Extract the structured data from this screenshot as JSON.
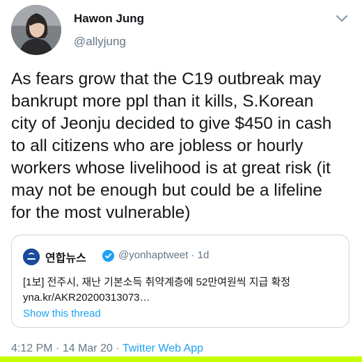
{
  "author": {
    "name": "Hawon Jung",
    "handle": "@allyjung"
  },
  "tweet": {
    "lines": [
      "As fears grow that the C19 outbreak may",
      "bankrupt more ppl than it kills, S.Korean",
      "city of Jeonju decided to give $450 in cash",
      "to all citizens who are jobless or hourly",
      "workers whose livelihood is at great risk (it",
      "may not be enough but could be a lifeline",
      "for the most vulnerable)"
    ]
  },
  "quoted": {
    "name": "연합뉴스",
    "handle": "@yonhaptweet",
    "separator": "·",
    "age": "1d",
    "text_line1": "[1보] 전주시, 재난 기본소득 취약계층에 52만여원씩 지급 확정",
    "text_line2": "yna.kr/AKR20200313073…",
    "show_thread": "Show this thread"
  },
  "footer": {
    "time": "4:12 PM",
    "sep1": "·",
    "date": "14 Mar 20",
    "sep2": "·",
    "app": "Twitter Web App"
  },
  "colors": {
    "link": "#1da1f2",
    "muted": "#657786",
    "text": "#14171a",
    "highlight": "#c6ff00"
  },
  "icons": {
    "caret": "chevron-down-icon",
    "verified": "verified-badge-icon"
  }
}
